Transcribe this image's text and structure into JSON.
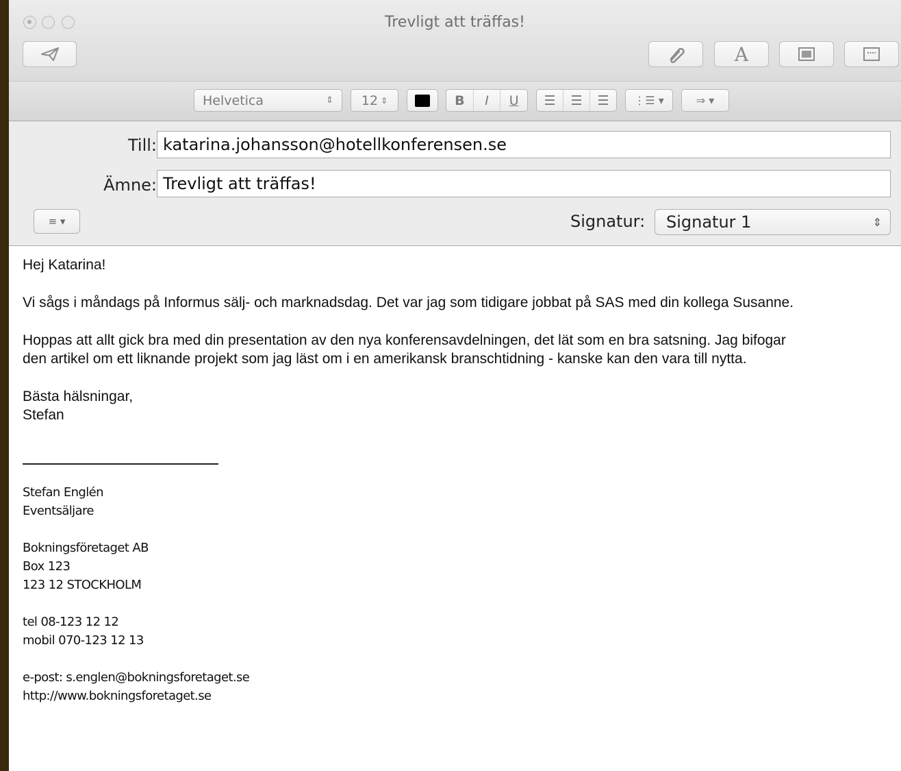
{
  "window": {
    "title": "Trevligt att träffas!"
  },
  "toolbar": {
    "send_icon": "paper-plane-icon",
    "attach_icon": "paperclip-icon",
    "fonts_icon": "font-a-icon",
    "photo_icon": "photo-browser-icon",
    "template_icon": "stationery-icon"
  },
  "format": {
    "font": "Helvetica",
    "size": "12",
    "bold": "B",
    "italic": "I",
    "underline": "U"
  },
  "header": {
    "to_label": "Till:",
    "to_value": "katarina.johansson@hotellkonferensen.se",
    "subject_label": "Ämne:",
    "subject_value": "Trevligt att träffas!",
    "signature_label": "Signatur:",
    "signature_value": "Signatur 1"
  },
  "message": {
    "greeting": "Hej Katarina!",
    "para1": "Vi sågs i måndags på Informus sälj- och marknadsdag. Det var jag som tidigare jobbat på SAS med din kollega Susanne.",
    "para2_line1": "Hoppas att allt gick bra med din presentation av den nya konferensavdelningen, det lät som en bra satsning.  Jag bifogar",
    "para2_line2": "den artikel om ett liknande projekt som jag läst om i en amerikansk branschtidning - kanske kan den vara till nytta.",
    "closing": "Bästa hälsningar,",
    "name": "Stefan"
  },
  "signature": {
    "name": "Stefan Englén",
    "role": "Eventsäljare",
    "company": "Bokningsföretaget AB",
    "box": "Box 123",
    "city": "123 12  STOCKHOLM",
    "tel": "tel 08-123 12 12",
    "mobile": "mobil 070-123 12 13",
    "email": "e-post: s.englen@bokningsforetaget.se",
    "web": "http://www.bokningsforetaget.se"
  }
}
